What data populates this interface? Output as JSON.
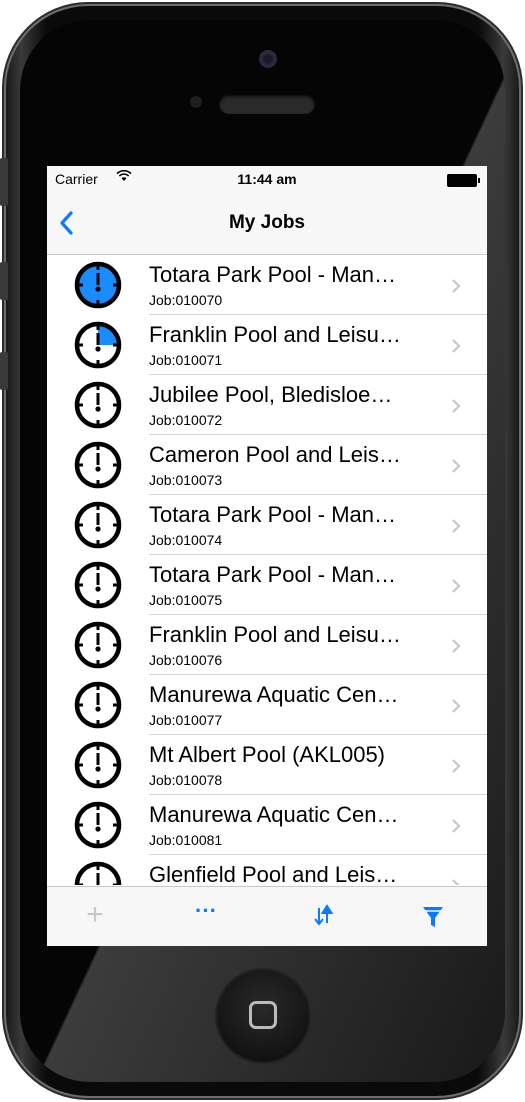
{
  "status_bar": {
    "carrier": "Carrier",
    "time": "11:44 am"
  },
  "nav": {
    "title": "My Jobs"
  },
  "colors": {
    "accent": "#0a7aff",
    "clock_fill": "#1a8cff"
  },
  "jobs": [
    {
      "title": "Totara Park Pool - Man…",
      "sub": "Job:010070",
      "progress": 1.0
    },
    {
      "title": "Franklin Pool and Leisu…",
      "sub": "Job:010071",
      "progress": 0.25
    },
    {
      "title": "Jubilee Pool, Bledisloe…",
      "sub": "Job:010072",
      "progress": 0
    },
    {
      "title": "Cameron Pool and Leis…",
      "sub": "Job:010073",
      "progress": 0
    },
    {
      "title": "Totara Park Pool - Man…",
      "sub": "Job:010074",
      "progress": 0
    },
    {
      "title": "Totara Park Pool - Man…",
      "sub": "Job:010075",
      "progress": 0
    },
    {
      "title": "Franklin Pool and Leisu…",
      "sub": "Job:010076",
      "progress": 0
    },
    {
      "title": "Manurewa Aquatic Cen…",
      "sub": "Job:010077",
      "progress": 0
    },
    {
      "title": "Mt Albert Pool (AKL005)",
      "sub": "Job:010078",
      "progress": 0
    },
    {
      "title": "Manurewa Aquatic Cen…",
      "sub": "Job:010081",
      "progress": 0
    },
    {
      "title": "Glenfield Pool and Leis…",
      "sub": "",
      "progress": 0
    }
  ],
  "toolbar": {
    "add_icon": "plus-icon",
    "more_icon": "ellipsis-icon",
    "sort_icon": "sort-arrows-icon",
    "filter_icon": "filter-funnel-icon",
    "more_label": "···",
    "add_label": "+"
  }
}
